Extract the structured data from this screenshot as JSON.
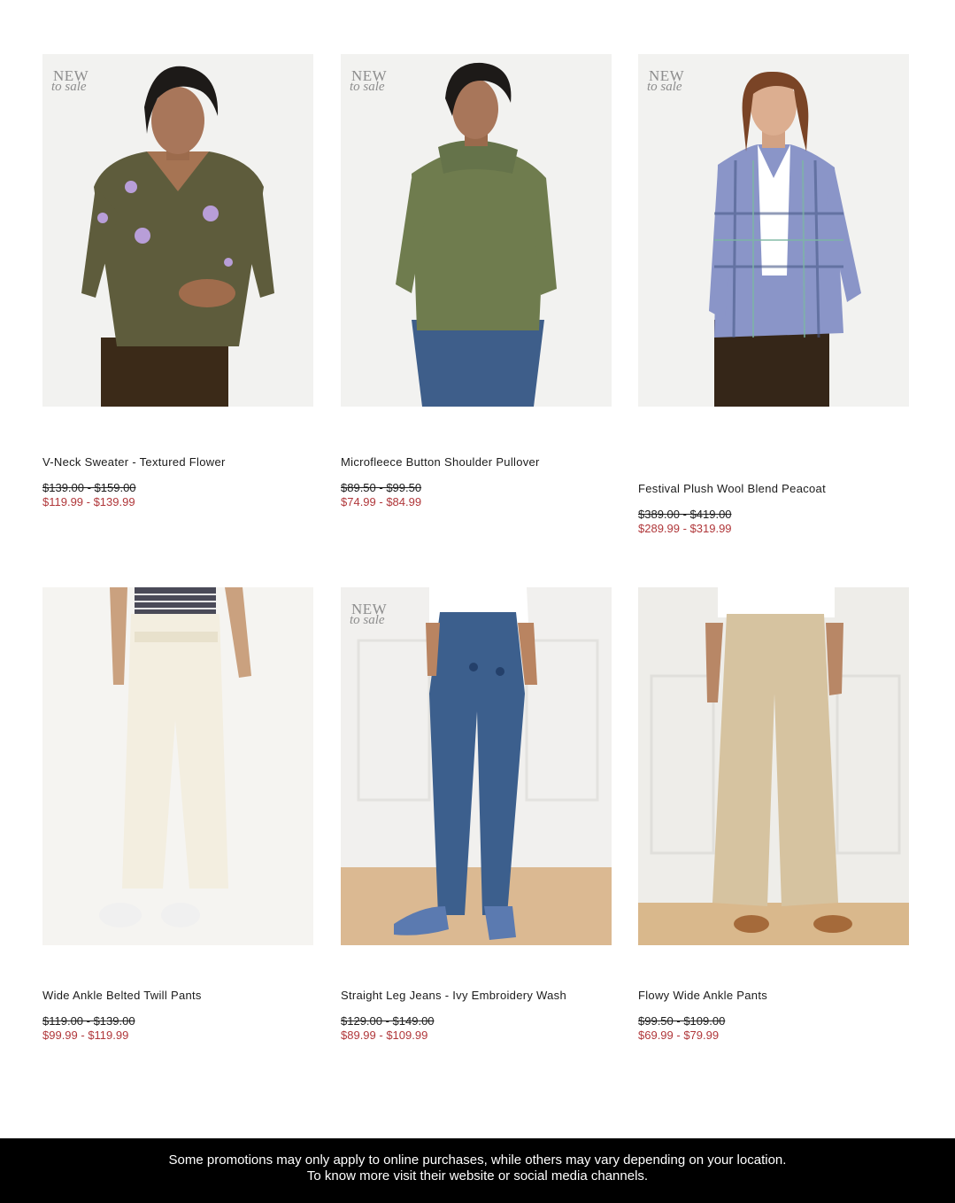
{
  "badge": {
    "line1": "NEW",
    "line2": "to sale"
  },
  "products": [
    {
      "title": "V-Neck Sweater - Textured Flower",
      "was": "$139.00 - $159.00",
      "now": "$119.99 - $139.99",
      "image": "green-floral-sweater-photo"
    },
    {
      "title": "Microfleece Button Shoulder Pullover",
      "was": "$89.50 - $99.50",
      "now": "$74.99 - $84.99",
      "image": "olive-pullover-photo"
    },
    {
      "title": "Festival Plush Wool Blend Peacoat",
      "was": "$389.00 - $419.00",
      "now": "$289.99 - $319.99",
      "image": "plaid-peacoat-photo"
    },
    {
      "title": "Wide Ankle Belted Twill Pants",
      "was": "$119.00 - $139.00",
      "now": "$99.99 - $119.99",
      "image": "cream-twill-pants-photo"
    },
    {
      "title": "Straight Leg Jeans - Ivy Embroidery Wash",
      "was": "$129.00 - $149.00",
      "now": "$89.99 - $109.99",
      "image": "embroidered-jeans-photo"
    },
    {
      "title": "Flowy Wide Ankle Pants",
      "was": "$99.50 - $109.00",
      "now": "$69.99 - $79.99",
      "image": "tan-wide-pants-photo"
    }
  ],
  "footer": {
    "line1": "Some promotions may only apply to online purchases, while others may vary depending on your location.",
    "line2": "To know more visit their website or social media channels."
  },
  "colors": {
    "sale_price": "#b0373a",
    "footer_bg": "#000000"
  }
}
